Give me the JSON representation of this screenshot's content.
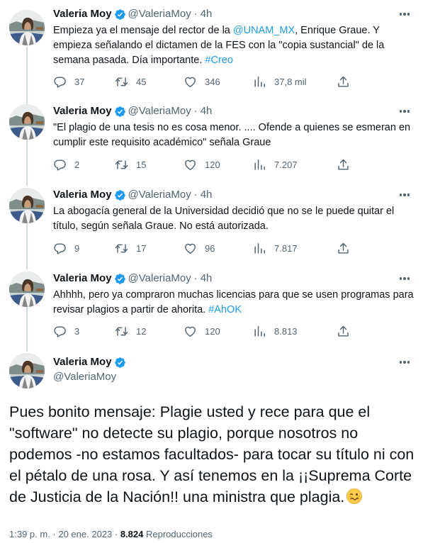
{
  "colors": {
    "link": "#1d9bf0",
    "verified": "#1d9bf0",
    "secondary": "#536471",
    "text": "#0f1419",
    "thread_line": "#cfd9de"
  },
  "icons": {
    "reply": "speech-bubble-icon",
    "retweet": "retweet-icon",
    "like": "heart-icon",
    "views": "bar-chart-icon",
    "share": "share-icon",
    "more": "more-dots-icon",
    "verified": "verified-badge-icon"
  },
  "tweets": [
    {
      "name": "Valeria Moy",
      "handle": "@ValeriaMoy",
      "dot": "·",
      "time": "4h",
      "text_a": "Empieza ya el mensaje del rector de la ",
      "mention": "@UNAM_MX",
      "text_b": ", Enrique Graue. Y empieza señalando el dictamen de la FES con la \"copia sustancial\" de la semana pasada. Día importante. ",
      "hashtag": "#Creo",
      "replies": "37",
      "retweets": "45",
      "likes": "346",
      "views": "37,8 mil"
    },
    {
      "name": "Valeria Moy",
      "handle": "@ValeriaMoy",
      "dot": "·",
      "time": "4h",
      "text": "\"El plagio de una tesis no es cosa menor. .... Ofende a quienes se esmeran en cumplir este requisito académico\" señala Graue",
      "replies": "2",
      "retweets": "15",
      "likes": "120",
      "views": "7.207"
    },
    {
      "name": "Valeria Moy",
      "handle": "@ValeriaMoy",
      "dot": "·",
      "time": "4h",
      "text": "La abogacía general de la Universidad decidió que no se le puede quitar el título, según señala Graue. No está autorizada.",
      "replies": "9",
      "retweets": "17",
      "likes": "96",
      "views": "7.817"
    },
    {
      "name": "Valeria Moy",
      "handle": "@ValeriaMoy",
      "dot": "·",
      "time": "4h",
      "text_a": "Ahhhh, pero ya compraron muchas licencias para que se usen programas para revisar plagios a partir de ahorita. ",
      "hashtag": "#AhOK",
      "replies": "3",
      "retweets": "12",
      "likes": "120",
      "views": "8.813"
    }
  ],
  "main": {
    "name": "Valeria Moy",
    "handle": "@ValeriaMoy",
    "text": "Pues bonito mensaje: Plagie usted y rece para que el \"software\" no detecte su plagio, porque nosotros no podemos -no estamos facultados- para tocar su título ni con el pétalo de una rosa. Y así tenemos en la ¡¡Suprema Corte de Justicia de la Nación!! una ministra que plagia.",
    "emoji": "woozy-face-emoji",
    "timestamp": "1:39 p. m. · 20 ene. 2023 · ",
    "views_count": "8.824",
    "views_label": " Reproducciones"
  }
}
